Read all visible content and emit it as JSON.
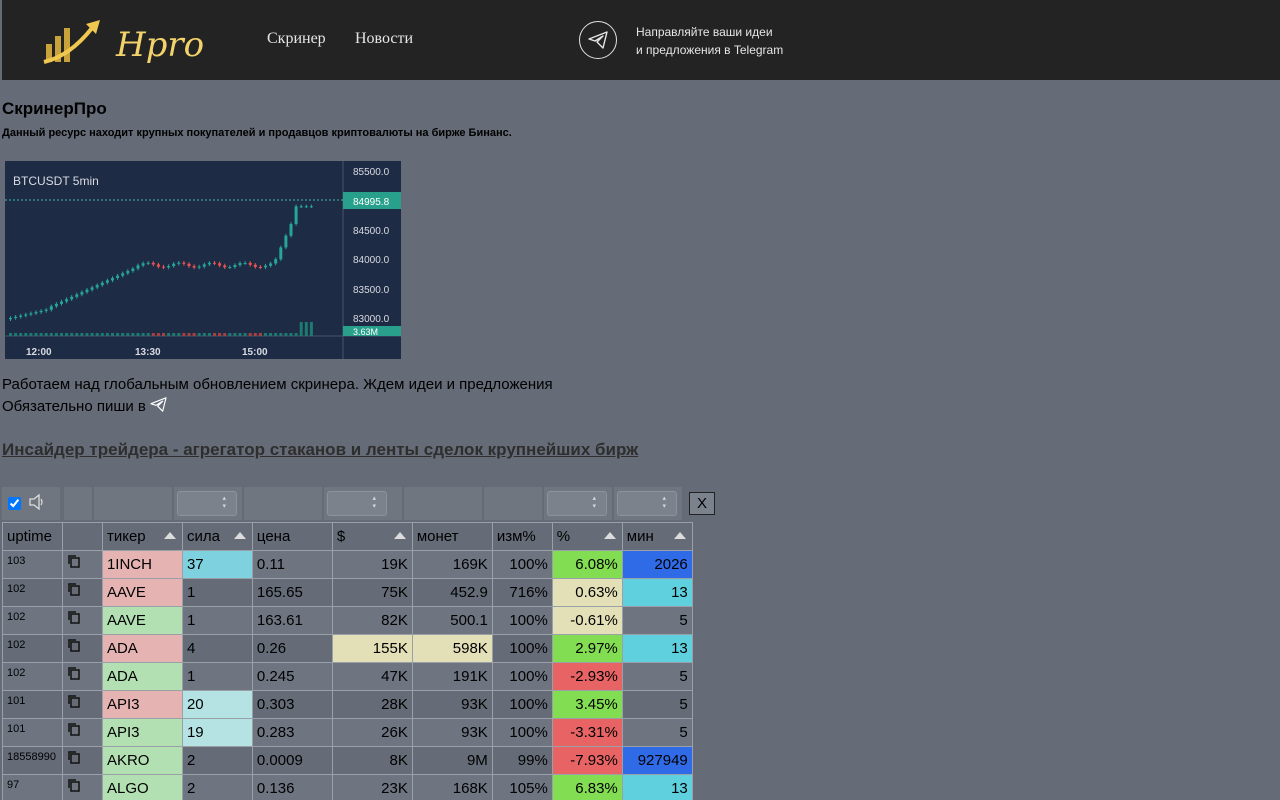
{
  "header": {
    "brand": "Hpro",
    "nav": [
      {
        "label": "Скринер"
      },
      {
        "label": "Новости"
      }
    ],
    "telegram_line1": "Направляйте ваши идеи",
    "telegram_line2": "и предложения в Telegram"
  },
  "intro": {
    "title": "СкринерПро",
    "subtitle": "Данный ресурс находит крупных покупателей и продавцов криптовалюты на бирже Бинанс."
  },
  "chart_data": {
    "type": "candlestick",
    "title": "BTCUSDT 5min",
    "x_ticks": [
      "12:00",
      "13:30",
      "15:00"
    ],
    "y_ticks": [
      "85500.0",
      "85000.0",
      "84500.0",
      "84000.0",
      "83500.0",
      "83000.0"
    ],
    "last_price": "84995.8",
    "volume_label": "3.63M",
    "ylim": [
      82900,
      85600
    ]
  },
  "messages": {
    "line1": "Работаем над глобальным обновлением скринера. Ждем идеи и предложения",
    "line2": "Обязательно пиши в",
    "insider_link": "Инсайдер трейдера - агрегатор стаканов и ленты сделок крупнейших бирж"
  },
  "filters": {
    "clear_label": "X"
  },
  "table": {
    "headers": [
      "uptime",
      "",
      "тикер",
      "сила",
      "цена",
      "$",
      "монет",
      "изм%",
      "%",
      "мин"
    ],
    "rows": [
      {
        "uptime": "103",
        "ticker": "1INCH",
        "power": "37",
        "price": "0.11",
        "usd": "19K",
        "coins": "169K",
        "chg": "100%",
        "pct": "6.08%",
        "min": "2026"
      },
      {
        "uptime": "102",
        "ticker": "AAVE",
        "power": "1",
        "price": "165.65",
        "usd": "75K",
        "coins": "452.9",
        "chg": "716%",
        "pct": "0.63%",
        "min": "13"
      },
      {
        "uptime": "102",
        "ticker": "AAVE",
        "power": "1",
        "price": "163.61",
        "usd": "82K",
        "coins": "500.1",
        "chg": "100%",
        "pct": "-0.61%",
        "min": "5"
      },
      {
        "uptime": "102",
        "ticker": "ADA",
        "power": "4",
        "price": "0.26",
        "usd": "155K",
        "coins": "598K",
        "chg": "100%",
        "pct": "2.97%",
        "min": "13"
      },
      {
        "uptime": "102",
        "ticker": "ADA",
        "power": "1",
        "price": "0.245",
        "usd": "47K",
        "coins": "191K",
        "chg": "100%",
        "pct": "-2.93%",
        "min": "5"
      },
      {
        "uptime": "101",
        "ticker": "API3",
        "power": "20",
        "price": "0.303",
        "usd": "28K",
        "coins": "93K",
        "chg": "100%",
        "pct": "3.45%",
        "min": "5"
      },
      {
        "uptime": "101",
        "ticker": "API3",
        "power": "19",
        "price": "0.283",
        "usd": "26K",
        "coins": "93K",
        "chg": "100%",
        "pct": "-3.31%",
        "min": "5"
      },
      {
        "uptime": "18558990",
        "ticker": "AKRO",
        "power": "2",
        "price": "0.0009",
        "usd": "8K",
        "coins": "9M",
        "chg": "99%",
        "pct": "-7.93%",
        "min": "927949"
      },
      {
        "uptime": "97",
        "ticker": "ALGO",
        "power": "2",
        "price": "0.136",
        "usd": "23K",
        "coins": "168K",
        "chg": "105%",
        "pct": "6.83%",
        "min": "13"
      }
    ]
  }
}
